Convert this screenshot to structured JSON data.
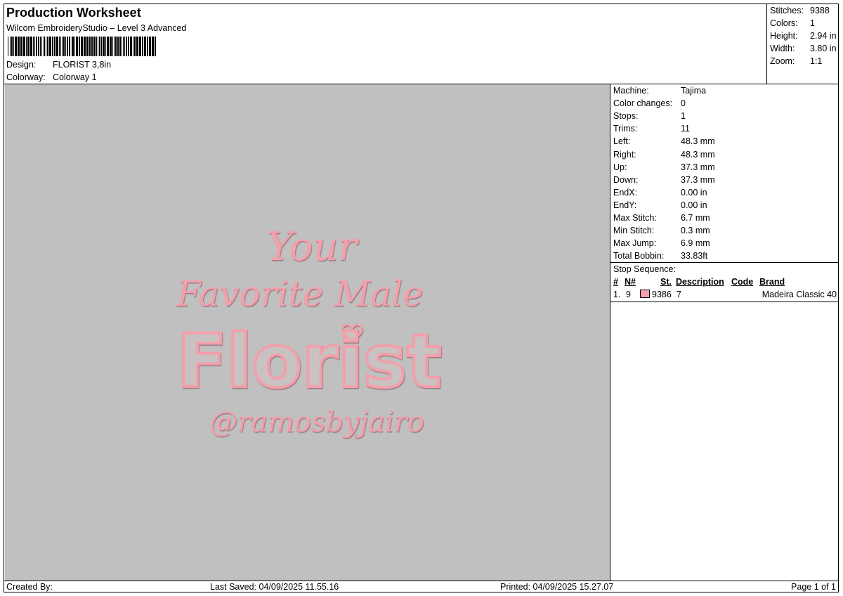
{
  "header": {
    "title": "Production Worksheet",
    "subtitle": "Wilcom EmbroideryStudio – Level 3 Advanced",
    "design_label": "Design:",
    "design_value": "FLORIST 3,8in",
    "colorway_label": "Colorway:",
    "colorway_value": "Colorway 1"
  },
  "stats": {
    "stitches_label": "Stitches:",
    "stitches_value": "9388",
    "colors_label": "Colors:",
    "colors_value": "1",
    "height_label": "Height:",
    "height_value": "2.94 in",
    "width_label": "Width:",
    "width_value": "3.80 in",
    "zoom_label": "Zoom:",
    "zoom_value": "1:1"
  },
  "machine_info": [
    {
      "label": "Machine:",
      "value": "Tajima"
    },
    {
      "label": "Color changes:",
      "value": "0"
    },
    {
      "label": "Stops:",
      "value": "1"
    },
    {
      "label": "Trims:",
      "value": "11"
    },
    {
      "label": "Left:",
      "value": "48.3 mm"
    },
    {
      "label": "Right:",
      "value": "48.3 mm"
    },
    {
      "label": "Up:",
      "value": "37.3 mm"
    },
    {
      "label": "Down:",
      "value": "37.3 mm"
    },
    {
      "label": "EndX:",
      "value": "0.00 in"
    },
    {
      "label": "EndY:",
      "value": "0.00 in"
    },
    {
      "label": "Max Stitch:",
      "value": "6.7 mm"
    },
    {
      "label": "Min Stitch:",
      "value": "0.3 mm"
    },
    {
      "label": "Max Jump:",
      "value": "6.9 mm"
    },
    {
      "label": "Total Bobbin:",
      "value": "33.83ft"
    }
  ],
  "stop_sequence": {
    "title": "Stop Sequence:",
    "columns": {
      "hash": "#",
      "n": "N#",
      "st": "St.",
      "description": "Description",
      "code": "Code",
      "brand": "Brand"
    },
    "rows": [
      {
        "index": "1.",
        "n": "9",
        "swatch_color": "#f2a0ab",
        "st": "9386",
        "code": "7",
        "brand": "Madeira Classic 40"
      }
    ]
  },
  "design": {
    "line1": "Your",
    "line2": "Favorite Male",
    "line3": "Florist",
    "line4": "@ramosbyjairo",
    "thread_color": "#f2a0ab",
    "background": "#c0c0c0"
  },
  "footer": {
    "created_by": "Created By:",
    "last_saved": "Last Saved: 04/09/2025 11.55.16",
    "printed": "Printed: 04/09/2025 15.27.07",
    "page": "Page 1 of 1"
  }
}
